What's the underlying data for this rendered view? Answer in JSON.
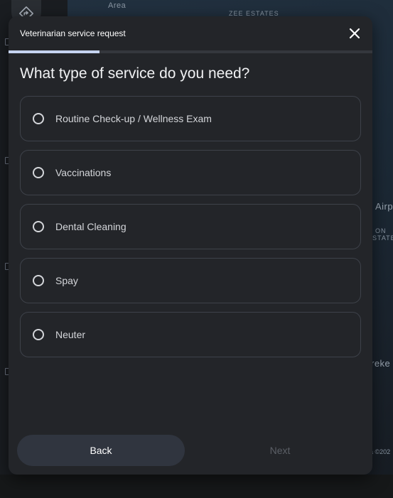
{
  "map": {
    "labels": [
      "Area",
      "ZEE ESTATES",
      "Airp",
      "ON",
      "STATE",
      "reke",
      "a ©202"
    ]
  },
  "modal": {
    "title": "Veterinarian service request",
    "progress": 0.25,
    "question": "What type of service do you need?",
    "options": [
      {
        "label": "Routine Check-up / Wellness Exam",
        "selected": false
      },
      {
        "label": "Vaccinations",
        "selected": false
      },
      {
        "label": "Dental Cleaning",
        "selected": false
      },
      {
        "label": "Spay",
        "selected": false
      },
      {
        "label": "Neuter",
        "selected": false
      }
    ],
    "back_label": "Back",
    "next_label": "Next",
    "next_enabled": false
  },
  "colors": {
    "modal_bg": "#232529",
    "progress_fill": "#c5d3f0",
    "back_bg": "#30353f",
    "next_disabled_text": "#5b5f66"
  },
  "icons": {
    "close": "close-icon",
    "map_fab": "directions-icon"
  }
}
